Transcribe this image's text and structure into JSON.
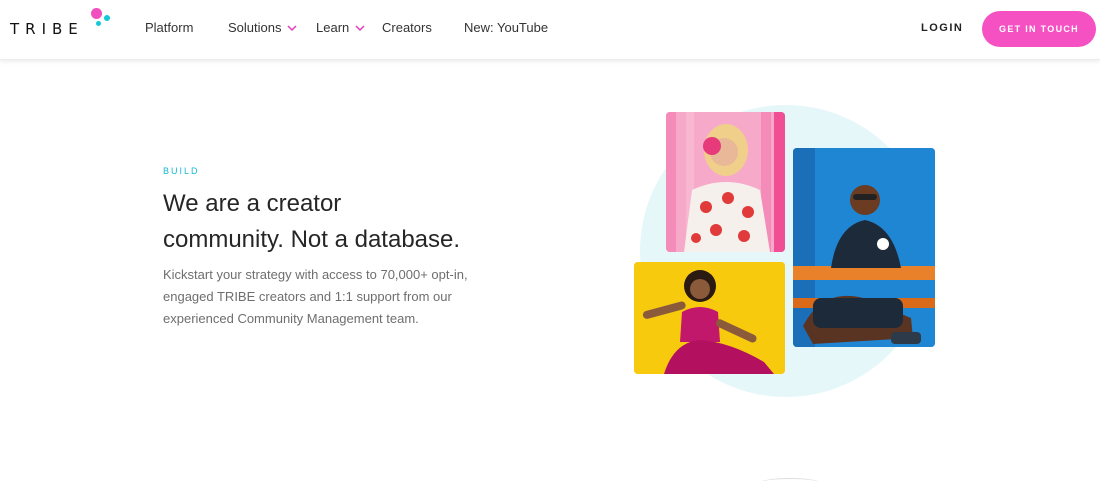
{
  "brand": {
    "logo_text": "TRIBE",
    "accent_pink": "#f551c3",
    "accent_cyan": "#15b8d2"
  },
  "nav": {
    "items": [
      {
        "label": "Platform",
        "has_dropdown": false
      },
      {
        "label": "Solutions",
        "has_dropdown": true
      },
      {
        "label": "Learn",
        "has_dropdown": true
      },
      {
        "label": "Creators",
        "has_dropdown": false
      },
      {
        "label": "New: YouTube",
        "has_dropdown": false
      }
    ],
    "login_label": "LOGIN",
    "cta_label": "GET IN TOUCH"
  },
  "hero": {
    "eyebrow": "BUILD",
    "headline_line1": "We are a creator",
    "headline_line2": "community. Not a database.",
    "body_line1": "Kickstart your strategy with access to 70,000+ opt-in,",
    "body_line2": "engaged TRIBE creators and 1:1 support from our",
    "body_line3": "experienced Community Management team."
  },
  "images": [
    {
      "name": "creator-photo-pink",
      "bg": "#f3a3c5"
    },
    {
      "name": "creator-photo-blue",
      "bg": "#1e7fcf"
    },
    {
      "name": "creator-photo-yellow",
      "bg": "#f8c90e"
    }
  ]
}
